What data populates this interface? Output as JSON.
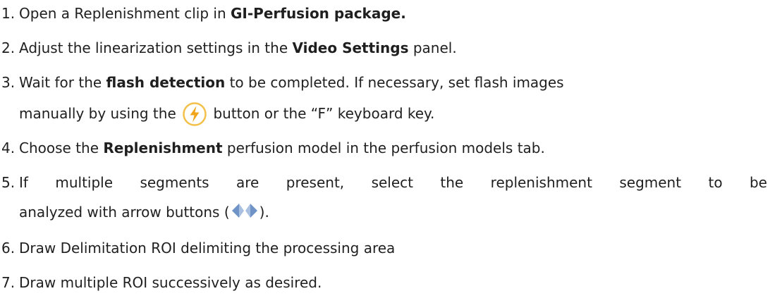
{
  "steps": [
    {
      "number": "1.",
      "before": "Open a Replenishment clip in ",
      "bold": "GI-Perfusion package."
    },
    {
      "number": "2.",
      "before": "Adjust the linearization settings in the ",
      "bold": "Video Settings",
      "after": " panel."
    },
    {
      "number": "3.",
      "before": "Wait for the ",
      "bold": "flash detection",
      "after": " to be completed. If necessary, set flash images",
      "line2_before": "manually by using the ",
      "icon": "flash-icon",
      "line2_after": " button or the “F” keyboard key."
    },
    {
      "number": "4.",
      "before": "Choose the ",
      "bold": "Replenishment",
      "after": " perfusion model in the perfusion models tab."
    },
    {
      "number": "5.",
      "before": "If multiple segments are present, select the replenishment segment to be",
      "line2_before": "analyzed with arrow buttons (",
      "icon": "arrow-buttons-icon",
      "line2_after": ")."
    },
    {
      "number": "6.",
      "before": "Draw Delimitation ROI delimiting the processing area"
    },
    {
      "number": "7.",
      "before": "Draw multiple ROI successively as desired."
    }
  ],
  "colors": {
    "text": "#1f1f1f",
    "flash_icon_ring": "#f3c04a",
    "flash_icon_bolt": "#f0a51c",
    "arrow_icon": "#6f93c6"
  }
}
